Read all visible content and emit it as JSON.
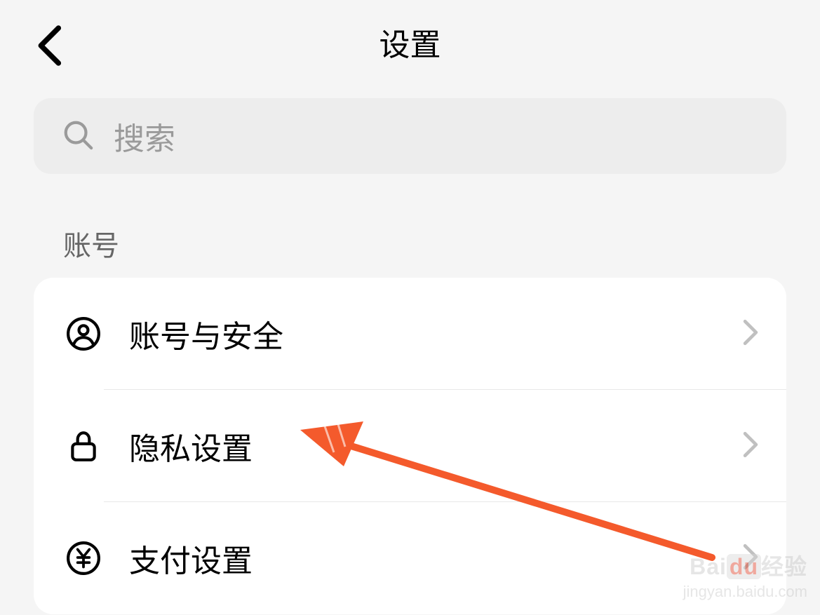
{
  "header": {
    "title": "设置"
  },
  "search": {
    "placeholder": "搜索"
  },
  "section": {
    "account_header": "账号"
  },
  "items": {
    "account_security": {
      "label": "账号与安全"
    },
    "privacy": {
      "label": "隐私设置"
    },
    "payment": {
      "label": "支付设置"
    }
  },
  "watermark": {
    "brand_prefix": "Bai",
    "brand_mid": "du",
    "brand_suffix": "经验",
    "url": "jingyan.baidu.com"
  },
  "annotation": {
    "arrow_color": "#f45a2c"
  }
}
